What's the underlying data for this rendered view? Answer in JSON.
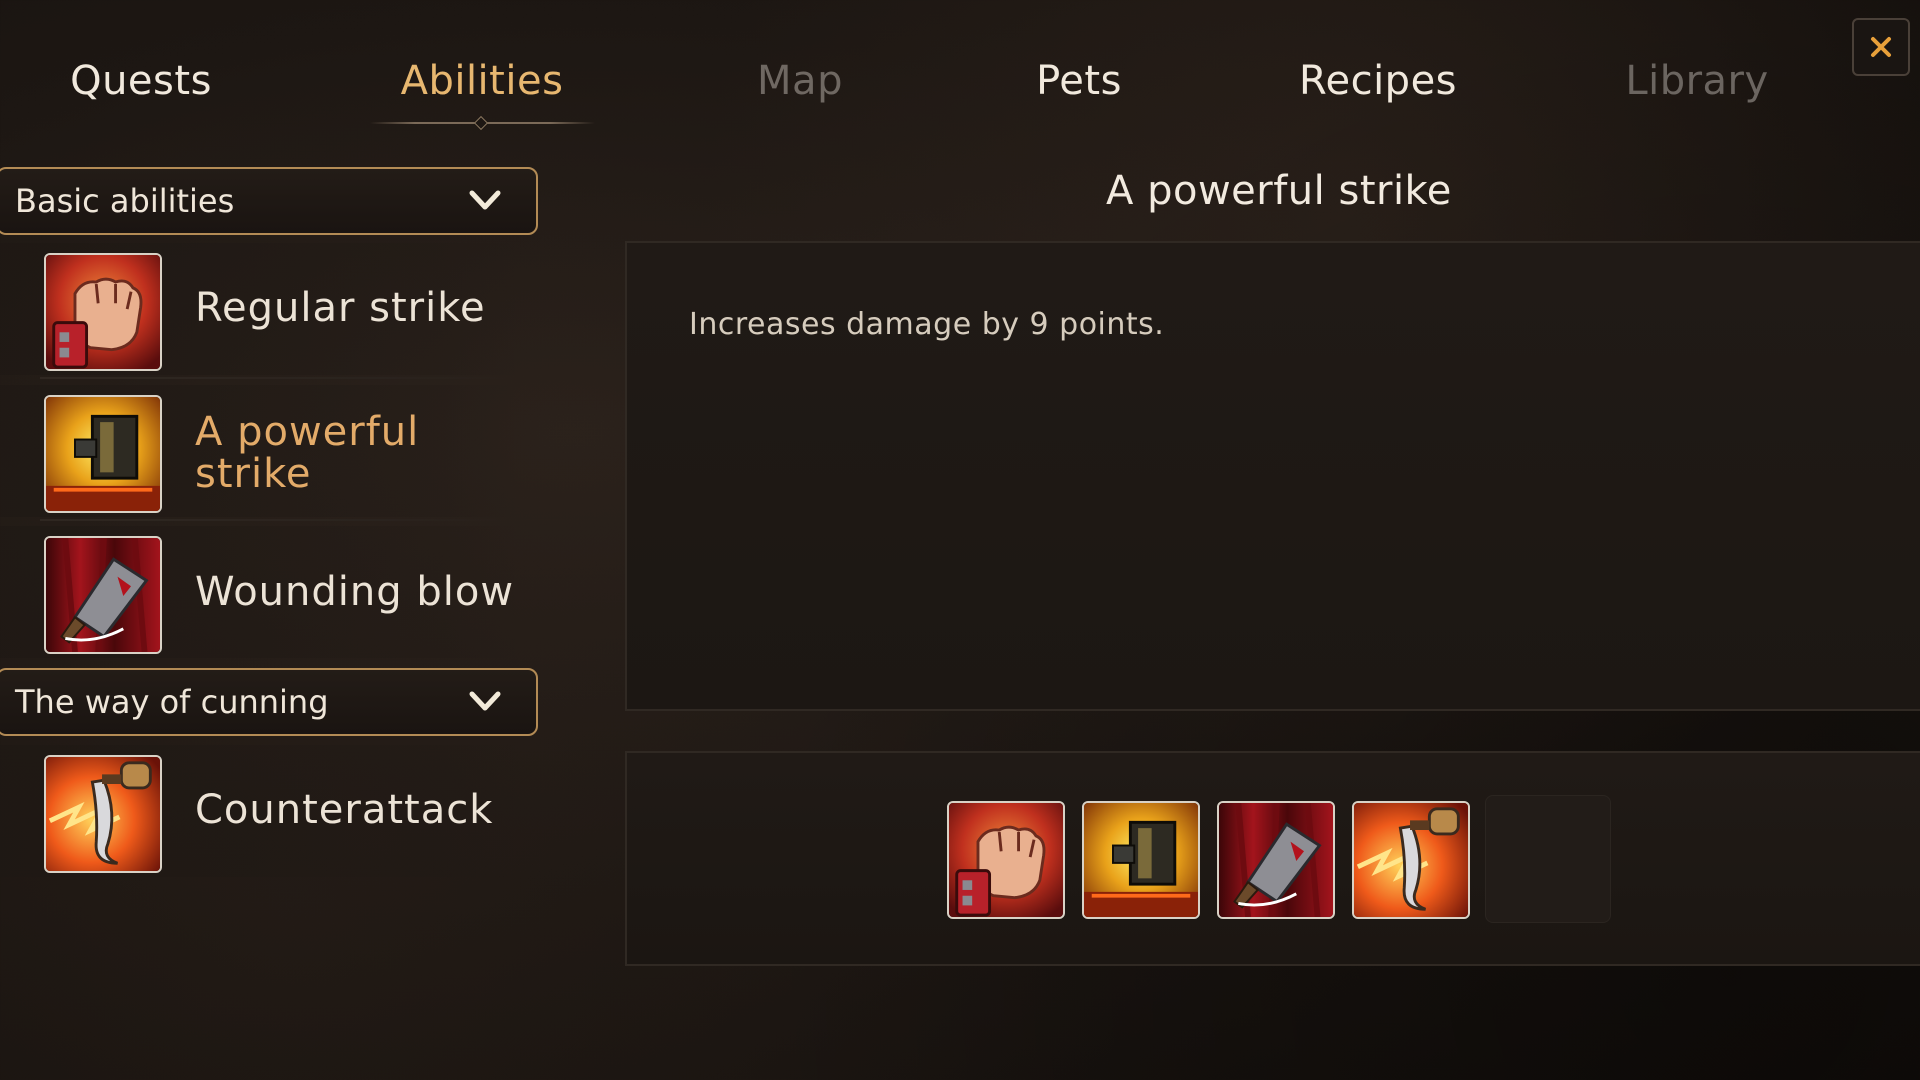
{
  "tabs": [
    {
      "label": "Quests",
      "state": "normal"
    },
    {
      "label": "Abilities",
      "state": "active"
    },
    {
      "label": "Map",
      "state": "disabled"
    },
    {
      "label": "Pets",
      "state": "normal"
    },
    {
      "label": "Recipes",
      "state": "normal"
    },
    {
      "label": "Library",
      "state": "disabled"
    }
  ],
  "close_icon": "close-x-icon",
  "groups": [
    {
      "label": "Basic abilities",
      "icon": "chevron-down-icon",
      "abilities": [
        {
          "name": "Regular strike",
          "icon": "fist-icon"
        },
        {
          "name": "A powerful strike",
          "icon": "hammer-icon",
          "selected": true
        },
        {
          "name": "Wounding blow",
          "icon": "cleaver-icon"
        }
      ]
    },
    {
      "label": "The way of cunning",
      "icon": "chevron-down-icon",
      "abilities": [
        {
          "name": "Counterattack",
          "icon": "dagger-icon"
        }
      ]
    }
  ],
  "detail": {
    "title": "A powerful strike",
    "description": "Increases damage by 9 points."
  },
  "slots": [
    {
      "icon": "fist-icon"
    },
    {
      "icon": "hammer-icon"
    },
    {
      "icon": "cleaver-icon"
    },
    {
      "icon": "dagger-icon"
    },
    {
      "icon": "empty-slot"
    }
  ],
  "colors": {
    "accent": "#e3ab69",
    "close_icon": "#e8a03a",
    "border_gold": "#b38b55"
  }
}
